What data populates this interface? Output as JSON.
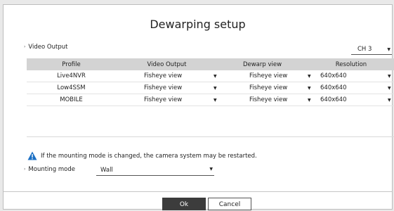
{
  "dialog": {
    "title": "Dewarping setup"
  },
  "video_output_section": {
    "label": "Video Output",
    "channel_select": {
      "value": "CH 3"
    }
  },
  "table": {
    "headers": [
      "Profile",
      "Video Output",
      "Dewarp view",
      "Resolution"
    ],
    "rows": [
      {
        "profile": "Live4NVR",
        "video_output": "Fisheye view",
        "dewarp_view": "Fisheye view",
        "resolution": "640x640"
      },
      {
        "profile": "Low4SSM",
        "video_output": "Fisheye view",
        "dewarp_view": "Fisheye view",
        "resolution": "640x640"
      },
      {
        "profile": "MOBILE",
        "video_output": "Fisheye view",
        "dewarp_view": "Fisheye view",
        "resolution": "640x640"
      }
    ]
  },
  "warning": {
    "icon": "warning-triangle-icon",
    "text": "If the mounting mode is changed, the camera system may be restarted.",
    "icon_color": "#1a6fc4"
  },
  "mounting_mode": {
    "label": "Mounting mode",
    "value": "Wall"
  },
  "buttons": {
    "ok": "Ok",
    "cancel": "Cancel"
  },
  "glyphs": {
    "caret_down": "▼",
    "section_arrow": "›"
  }
}
